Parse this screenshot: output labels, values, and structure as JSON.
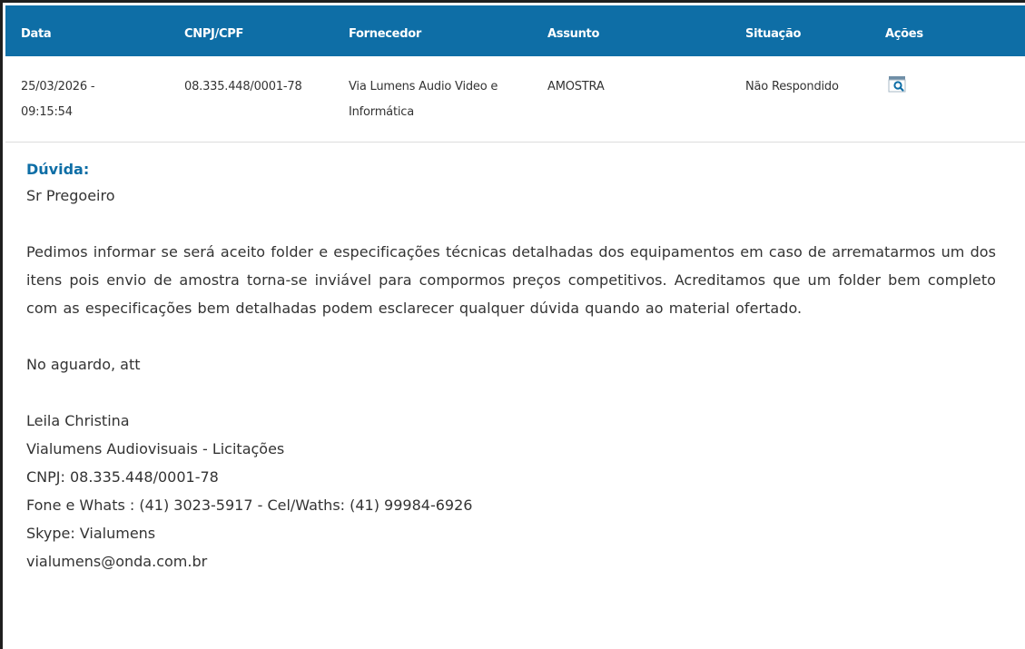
{
  "table": {
    "headers": {
      "data": "Data",
      "cnpj": "CNPJ/CPF",
      "fornecedor": "Fornecedor",
      "assunto": "Assunto",
      "situacao": "Situação",
      "acoes": "Ações"
    },
    "row": {
      "data_line1": "25/03/2026 -",
      "data_line2": "09:15:54",
      "cnpj": "08.335.448/0001-78",
      "fornecedor_line1": "Via Lumens Audio Video e",
      "fornecedor_line2": "Informática",
      "assunto": "AMOSTRA",
      "situacao": "Não Respondido",
      "action_icon": "search-document-icon"
    }
  },
  "detail": {
    "title": "Dúvida:",
    "greeting": "Sr Pregoeiro",
    "body": "Pedimos informar se será aceito folder e especificações técnicas detalhadas dos equipamentos em caso de arrematarmos um dos itens pois envio de amostra torna-se inviável para compormos preços competitivos. Acreditamos que um folder bem completo com as especificações bem detalhadas podem esclarecer qualquer dúvida quando ao material ofertado.",
    "closing": "No aguardo, att",
    "signature": {
      "name": "Leila Christina",
      "company": "Vialumens Audiovisuais - Licitações",
      "cnpj": "CNPJ: 08.335.448/0001-78",
      "phone": "Fone e Whats : (41) 3023-5917 - Cel/Waths: (41) 99984-6926",
      "skype": "Skype: Vialumens",
      "email": "vialumens@onda.com.br"
    }
  },
  "colors": {
    "header_bg": "#0e6ea6",
    "title_blue": "#0e6ea6",
    "text": "#333333"
  }
}
